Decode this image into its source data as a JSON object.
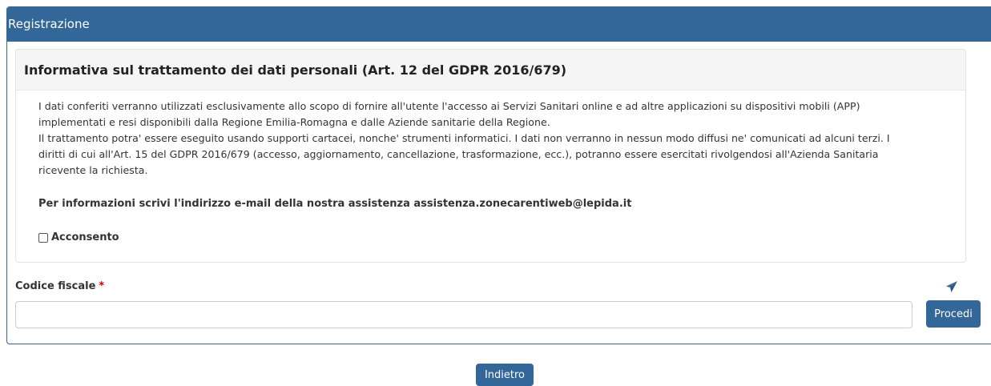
{
  "panel": {
    "title": "Registrazione",
    "collapse_glyph": "˅"
  },
  "privacy": {
    "heading": "Informativa sul trattamento dei dati personali (Art. 12 del GDPR 2016/679)",
    "lines": [
      "I dati conferiti verranno utilizzati esclusivamente allo scopo di fornire all'utente l'accesso ai Servizi Sanitari online e ad altre applicazioni su dispositivi mobili (APP)",
      "implementati e resi disponibili dalla Regione Emilia-Romagna e dalle Aziende sanitarie della Regione.",
      "Il trattamento potra' essere eseguito usando supporti cartacei, nonche' strumenti informatici. I dati non verranno in nessun modo diffusi ne' comunicati ad alcuni terzi. I",
      "diritti di cui all'Art. 15 del GDPR 2016/679 (accesso, aggiornamento, cancellazione, trasformazione, ecc.), potranno essere esercitati rivolgendosi all'Azienda Sanitaria",
      "ricevente la richiesta."
    ],
    "contact": "Per informazioni scrivi l'indirizzo e-mail della nostra assistenza assistenza.zonecarentiweb@lepida.it",
    "consent_label": "Acconsento",
    "consent_checked": false
  },
  "form": {
    "codice_fiscale_label": "Codice fiscale",
    "required_mark": "*",
    "codice_fiscale_value": "",
    "submit_label": "Procedi"
  },
  "back_label": "Indietro",
  "colors": {
    "primary": "#336699",
    "required": "#cc0000"
  },
  "icons": {
    "send": "paper-plane-icon",
    "collapse": "chevron-down-icon"
  }
}
